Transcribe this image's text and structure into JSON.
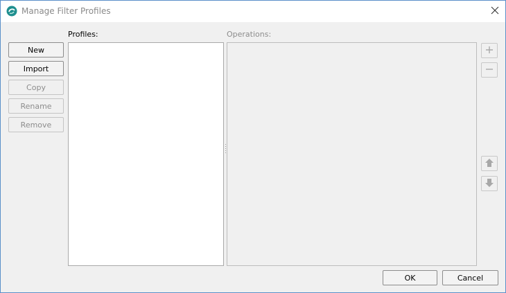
{
  "window": {
    "title": "Manage Filter Profiles"
  },
  "icons": {
    "app": "app-logo-icon",
    "close": "close-icon",
    "add": "plus-icon",
    "remove": "minus-icon",
    "up": "arrow-up-icon",
    "down": "arrow-down-icon"
  },
  "left_buttons": {
    "new": "New",
    "import": "Import",
    "copy": "Copy",
    "rename": "Rename",
    "remove": "Remove"
  },
  "profiles": {
    "label": "Profiles:",
    "items": []
  },
  "operations": {
    "label": "Operations:",
    "items": []
  },
  "footer": {
    "ok": "OK",
    "cancel": "Cancel"
  },
  "colors": {
    "accent": "#1f8f8f",
    "window_border": "#5a8fc9",
    "dialog_bg": "#f0f0f0"
  }
}
